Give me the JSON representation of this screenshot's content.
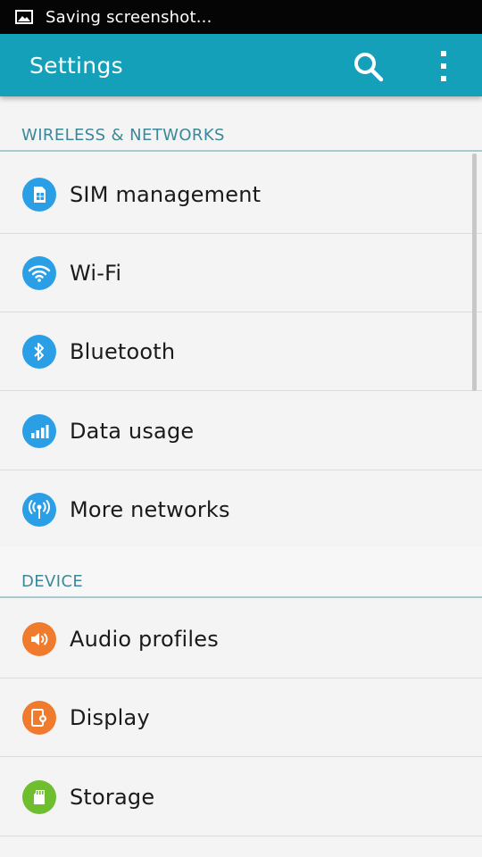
{
  "status_bar": {
    "icon": "image-icon",
    "text": "Saving screenshot..."
  },
  "app_bar": {
    "title": "Settings",
    "search_icon": "search-icon",
    "overflow_icon": "more-vert-icon"
  },
  "sections": [
    {
      "title": "WIRELESS & NETWORKS",
      "items": [
        {
          "label": "SIM management",
          "icon": "sim-card-icon",
          "color": "#2b9fe6"
        },
        {
          "label": "Wi-Fi",
          "icon": "wifi-icon",
          "color": "#2b9fe6"
        },
        {
          "label": "Bluetooth",
          "icon": "bluetooth-icon",
          "color": "#2b9fe6"
        },
        {
          "label": "Data usage",
          "icon": "data-usage-icon",
          "color": "#2b9fe6"
        },
        {
          "label": "More networks",
          "icon": "antenna-icon",
          "color": "#2b9fe6"
        }
      ]
    },
    {
      "title": "DEVICE",
      "items": [
        {
          "label": "Audio profiles",
          "icon": "speaker-icon",
          "color": "#f07a2d"
        },
        {
          "label": "Display",
          "icon": "display-icon",
          "color": "#f07a2d"
        },
        {
          "label": "Storage",
          "icon": "sd-card-icon",
          "color": "#6fbe2f"
        }
      ]
    }
  ],
  "colors": {
    "app_bar": "#13a0b8",
    "section_header_text": "#3c8799",
    "network_icon": "#2b9fe6",
    "device_orange": "#f07a2d",
    "storage_green": "#6fbe2f"
  }
}
